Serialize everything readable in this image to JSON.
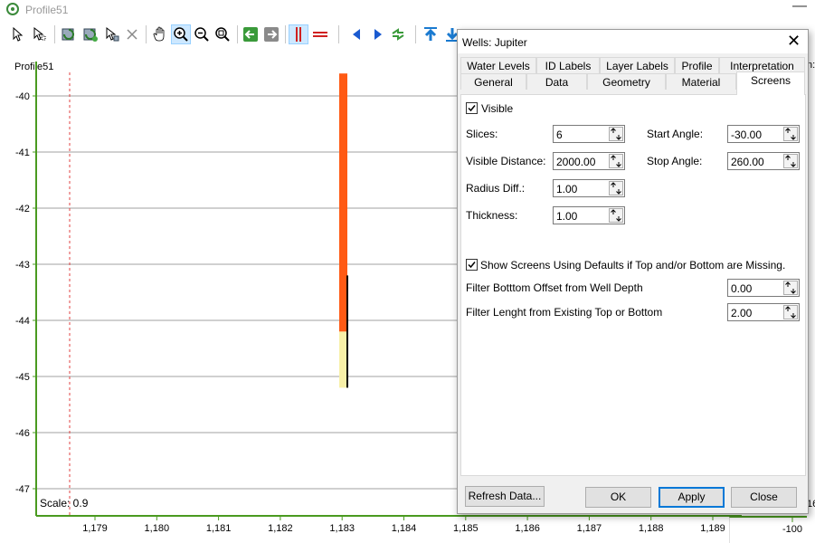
{
  "window": {
    "title": "Profile51",
    "minimize": "—"
  },
  "profile": {
    "label": "Profile51",
    "scale_text": "Scale: 0.9",
    "y_ticks": [
      "-40",
      "-41",
      "-42",
      "-43",
      "-44",
      "-45",
      "-46",
      "-47"
    ],
    "x_ticks": [
      "1,179",
      "1,180",
      "1,181",
      "1,182",
      "1,183",
      "1,184",
      "1,185",
      "1,186",
      "1,187",
      "1,188",
      "1,189"
    ],
    "right_axis_tick": "-100",
    "right_partial_text": "n:",
    "right_partial_tick": "16",
    "well": {
      "orange_top": -39.6,
      "orange_bottom": -44.2,
      "yellow_top": -44.2,
      "yellow_bottom": -45.2,
      "screen_top": -43.2,
      "screen_bottom": -45.2,
      "x": 1183
    },
    "colors": {
      "orange": "#ff5a14",
      "yellow": "#f8f0a8",
      "axis": "#4a9a20",
      "grid": "#a0a0a0",
      "dashed": "#e04040"
    }
  },
  "toolbar": {
    "icons": [
      "select-arrow-icon",
      "select-node-icon",
      "refresh-layer-icon",
      "refresh-all-icon",
      "edit-select-icon",
      "delete-icon",
      "pan-hand-icon",
      "zoom-in-icon",
      "zoom-out-icon",
      "zoom-extent-icon",
      "back-arrow-icon",
      "forward-arrow-icon",
      "vertical-line-icon",
      "horizontal-line-icon",
      "left-triangle-icon",
      "right-triangle-icon",
      "sync-icon",
      "move-top-icon",
      "move-bottom-icon"
    ]
  },
  "dialog": {
    "title": "Wells: Jupiter",
    "tabs_row1": [
      "Water Levels",
      "ID Labels",
      "Layer Labels",
      "Profile",
      "Interpretation"
    ],
    "tabs_row2": [
      "General",
      "Data",
      "Geometry",
      "Material",
      "Screens"
    ],
    "selected_tab": "Screens",
    "visible": {
      "label": "Visible",
      "checked": true
    },
    "slices": {
      "label": "Slices:",
      "value": "6"
    },
    "visible_distance": {
      "label": "Visible Distance:",
      "value": "2000.00"
    },
    "radius_diff": {
      "label": "Radius Diff.:",
      "value": "1.00"
    },
    "thickness": {
      "label": "Thickness:",
      "value": "1.00"
    },
    "start_angle": {
      "label": "Start Angle:",
      "value": "-30.00"
    },
    "stop_angle": {
      "label": "Stop Angle:",
      "value": "260.00"
    },
    "show_defaults": {
      "label": "Show Screens Using Defaults if Top and/or Bottom are Missing.",
      "checked": true
    },
    "filter_bottom": {
      "label": "Filter Botttom Offset from Well Depth",
      "value": "0.00"
    },
    "filter_length": {
      "label": "Filter Lenght from Existing Top or Bottom",
      "value": "2.00"
    },
    "buttons": {
      "refresh": "Refresh Data...",
      "ok": "OK",
      "apply": "Apply",
      "close": "Close"
    }
  }
}
